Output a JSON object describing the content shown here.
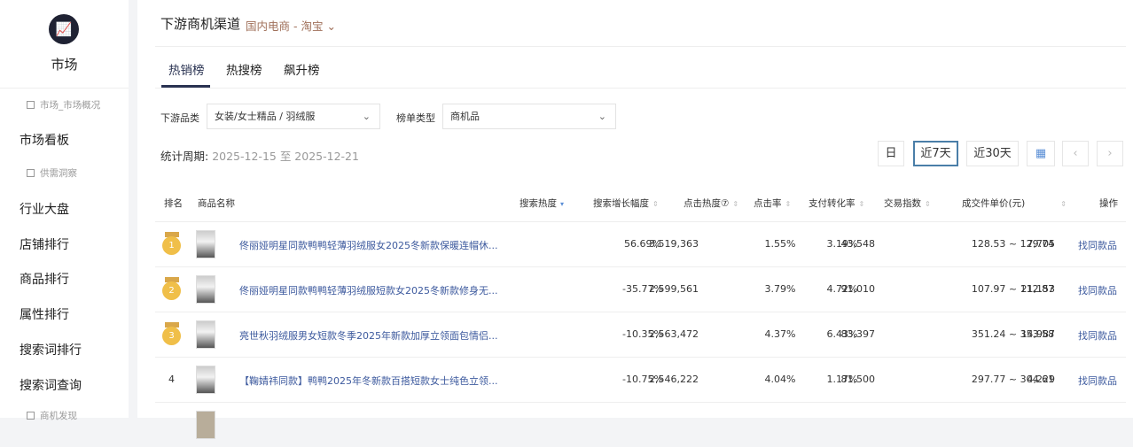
{
  "sidebar": {
    "title": "市场",
    "groups": [
      "市场_市场概况",
      "供需洞察",
      "商机发现"
    ],
    "items": [
      "市场看板",
      "行业大盘",
      "店铺排行",
      "商品排行",
      "属性排行",
      "搜索词排行",
      "搜索词查询"
    ]
  },
  "header": {
    "title": "下游商机渠道",
    "channel": "国内电商 - 淘宝"
  },
  "tabs": [
    "热销榜",
    "热搜榜",
    "飙升榜"
  ],
  "filters": {
    "category_label": "下游品类",
    "category_value": "女装/女士精品 / 羽绒服",
    "type_label": "榜单类型",
    "type_value": "商机品"
  },
  "period": {
    "label": "统计周期:",
    "value": "2025-12-15 至 2025-12-21"
  },
  "range_buttons": [
    "日",
    "近7天",
    "近30天"
  ],
  "table": {
    "headers": [
      "排名",
      "商品名称",
      "搜索热度",
      "搜索增长幅度",
      "点击热度⑦",
      "点击率",
      "支付转化率",
      "交易指数",
      "成交件单价(元)",
      "操作"
    ],
    "rows": [
      {
        "rank": "1",
        "name": "佟丽娅明星同款鸭鸭轻薄羽绒服女2025冬新款保暖连帽休...",
        "search": "3,519,363",
        "growth": "56.69%",
        "click_heat": "43,548",
        "ctr": "1.55%",
        "cvr": "3.19%",
        "trade": "7,705",
        "price": "128.53 ~ 129.74",
        "action": "找同款品"
      },
      {
        "rank": "2",
        "name": "佟丽娅明星同款鸭鸭轻薄羽绒服短款女2025冬新款修身无...",
        "search": "2,599,561",
        "growth": "-35.77%",
        "click_heat": "91,010",
        "ctr": "3.79%",
        "cvr": "4.72%",
        "trade": "21,153",
        "price": "107.97 ~ 112.87",
        "action": "找同款品"
      },
      {
        "rank": "3",
        "name": "亮世秋羽绒服男女短款冬季2025年新款加厚立领面包情侣...",
        "search": "2,563,472",
        "growth": "-10.35%",
        "click_heat": "83,397",
        "ctr": "4.37%",
        "cvr": "6.43%",
        "trade": "14,987",
        "price": "351.24 ~ 353.58",
        "action": "找同款品"
      },
      {
        "rank": "4",
        "name": "【鞠婧祎同款】鸭鸭2025年冬新款百搭短款女士纯色立领...",
        "search": "2,546,222",
        "growth": "-10.75%",
        "click_heat": "81,500",
        "ctr": "4.04%",
        "cvr": "1.17%",
        "trade": "4,229",
        "price": "297.77 ~ 304.61",
        "action": "找同款品"
      }
    ]
  }
}
